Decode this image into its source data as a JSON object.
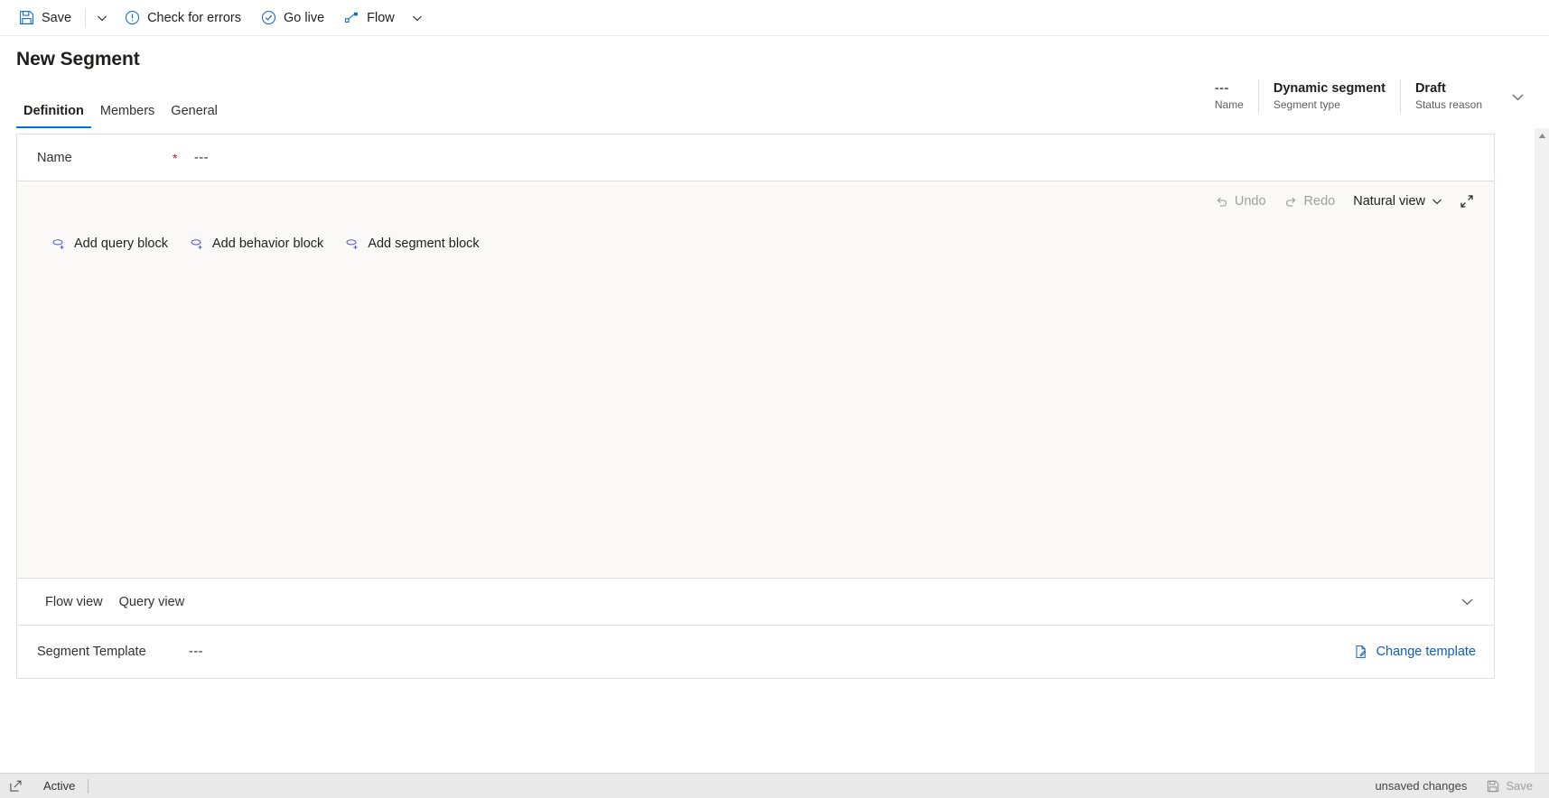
{
  "commandbar": {
    "save_label": "Save",
    "save_icon": "save-floppy-icon",
    "save_caret_icon": "chevron-down-icon",
    "check_errors_label": "Check for errors",
    "check_errors_icon": "exclamation-circle-icon",
    "go_live_label": "Go live",
    "go_live_icon": "check-circle-icon",
    "flow_label": "Flow",
    "flow_icon": "flow-node-icon",
    "flow_caret_icon": "chevron-down-icon"
  },
  "header": {
    "title": "New Segment",
    "fields": [
      {
        "value": "---",
        "label": "Name"
      },
      {
        "value": "Dynamic segment",
        "label": "Segment type"
      },
      {
        "value": "Draft",
        "label": "Status reason"
      }
    ],
    "expand_icon": "chevron-down-icon"
  },
  "tabs": [
    {
      "label": "Definition",
      "selected": true
    },
    {
      "label": "Members",
      "selected": false
    },
    {
      "label": "General",
      "selected": false
    }
  ],
  "accent_color": "#0078d4",
  "form": {
    "name_label": "Name",
    "name_required_marker": "*",
    "name_value": "---"
  },
  "canvas_toolbar": {
    "undo_label": "Undo",
    "undo_icon": "undo-arrow-icon",
    "undo_enabled": false,
    "redo_label": "Redo",
    "redo_icon": "redo-arrow-icon",
    "redo_enabled": false,
    "view_mode_label": "Natural view",
    "view_mode_caret_icon": "chevron-down-icon",
    "expand_icon": "expand-diagonal-icon"
  },
  "block_actions": [
    {
      "label": "Add query block",
      "icon": "add-query-block-icon"
    },
    {
      "label": "Add behavior block",
      "icon": "add-behavior-block-icon"
    },
    {
      "label": "Add segment block",
      "icon": "add-segment-block-icon"
    }
  ],
  "views": {
    "tabs": [
      {
        "label": "Flow view"
      },
      {
        "label": "Query view"
      }
    ],
    "collapse_icon": "chevron-down-icon"
  },
  "template": {
    "label": "Segment Template",
    "value": "---",
    "change_label": "Change template",
    "change_icon": "edit-document-icon"
  },
  "statusbar": {
    "expand_icon": "popout-window-icon",
    "state_label": "Active",
    "unsaved_label": "unsaved changes",
    "save_label": "Save",
    "save_icon": "save-floppy-icon"
  },
  "scrollbar": {
    "up_icon": "scroll-up-arrow-icon",
    "down_icon": "scroll-down-arrow-icon"
  }
}
